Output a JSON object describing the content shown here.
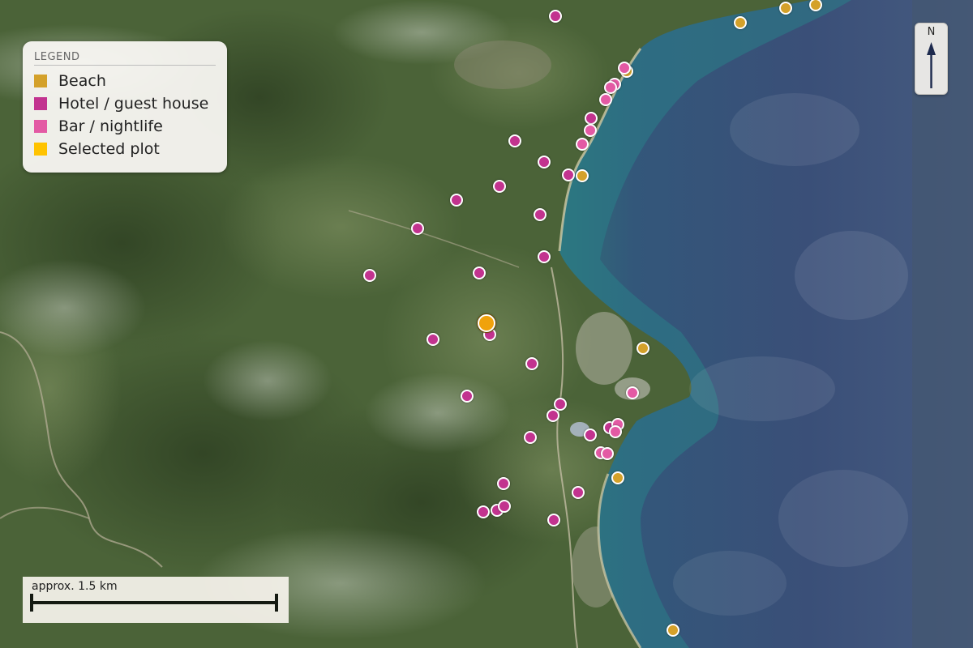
{
  "legend": {
    "title": "LEGEND",
    "items": [
      {
        "label": "Beach",
        "color": "#d4a12a"
      },
      {
        "label": "Hotel / guest house",
        "color": "#c2338f"
      },
      {
        "label": "Bar / nightlife",
        "color": "#e35aa4"
      },
      {
        "label": "Selected plot",
        "color": "#ffc300"
      }
    ]
  },
  "compass": {
    "label": "N"
  },
  "scale": {
    "label": "approx. 1.5 km"
  },
  "colors": {
    "beach": "#d4a12a",
    "hotel": "#c2338f",
    "bar": "#e35aa4",
    "selected": "#f0a20c",
    "sea": "#3c5477",
    "land": "#4b6338"
  }
}
